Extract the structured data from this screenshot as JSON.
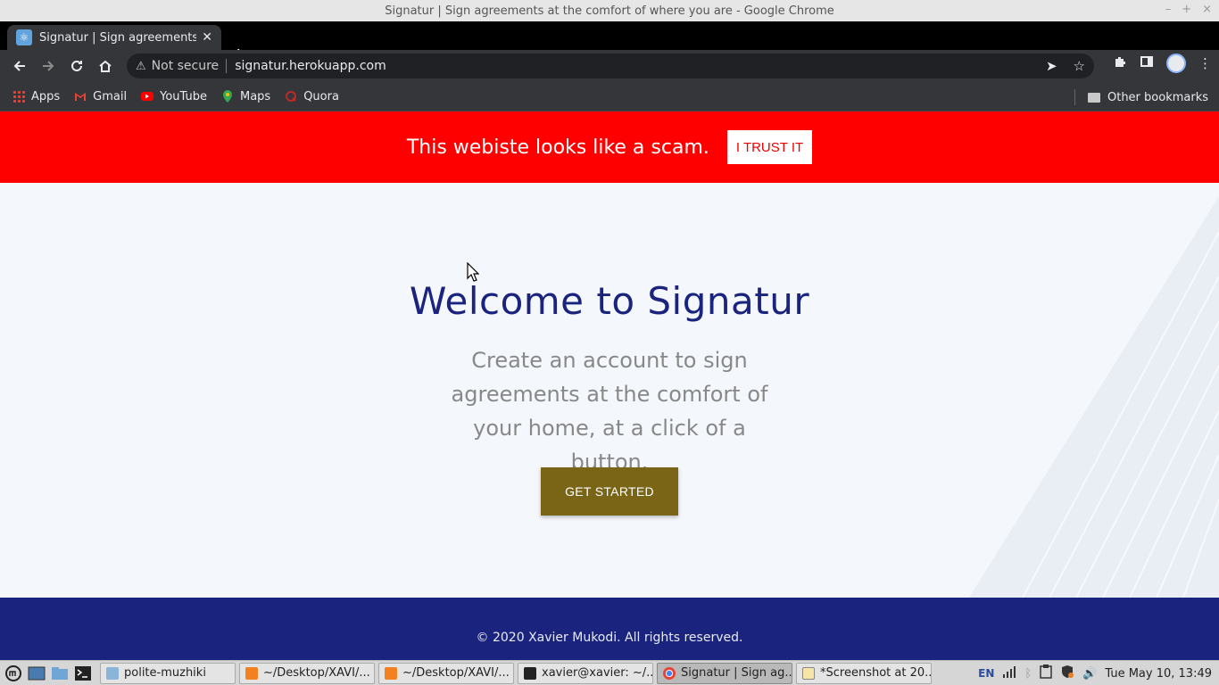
{
  "window": {
    "title": "Signatur | Sign agreements at the comfort of where you are - Google Chrome",
    "controls": [
      "–",
      "+",
      "×"
    ]
  },
  "browser": {
    "tab_title": "Signatur | Sign agreements at",
    "new_tab": "+",
    "security_label": "Not secure",
    "url": "signatur.herokuapp.com"
  },
  "bookmarks": {
    "items": [
      {
        "label": "Apps",
        "icon": "apps-grid-icon"
      },
      {
        "label": "Gmail",
        "icon": "gmail-icon"
      },
      {
        "label": "YouTube",
        "icon": "youtube-icon"
      },
      {
        "label": "Maps",
        "icon": "maps-icon"
      },
      {
        "label": "Quora",
        "icon": "quora-icon"
      }
    ],
    "other": "Other bookmarks"
  },
  "page": {
    "banner_text": "This webiste looks like a scam.",
    "trust_button": "I TRUST IT",
    "heading": "Welcome to Signatur",
    "subtitle": "Create an account to sign agreements at the comfort of your home, at a click of a button.",
    "cta": "GET STARTED",
    "footer": "© 2020 Xavier Mukodi. All rights reserved.",
    "colors": {
      "banner": "#ff0000",
      "heading": "#1a237e",
      "cta": "#7a6416",
      "footer": "#1a237e"
    }
  },
  "taskbar": {
    "tasks": [
      {
        "label": "polite-muzhiki",
        "icon": "folder-icon",
        "active": false
      },
      {
        "label": "~/Desktop/XAVI/...",
        "icon": "sublime-icon",
        "active": false
      },
      {
        "label": "~/Desktop/XAVI/...",
        "icon": "sublime-icon",
        "active": false
      },
      {
        "label": "xavier@xavier: ~/...",
        "icon": "terminal-icon",
        "active": false
      },
      {
        "label": "Signatur | Sign ag...",
        "icon": "chrome-icon",
        "active": true
      },
      {
        "label": "*Screenshot at 20...",
        "icon": "text-editor-icon",
        "active": false
      }
    ],
    "lang": "EN",
    "clock": "Tue May 10, 13:49"
  }
}
